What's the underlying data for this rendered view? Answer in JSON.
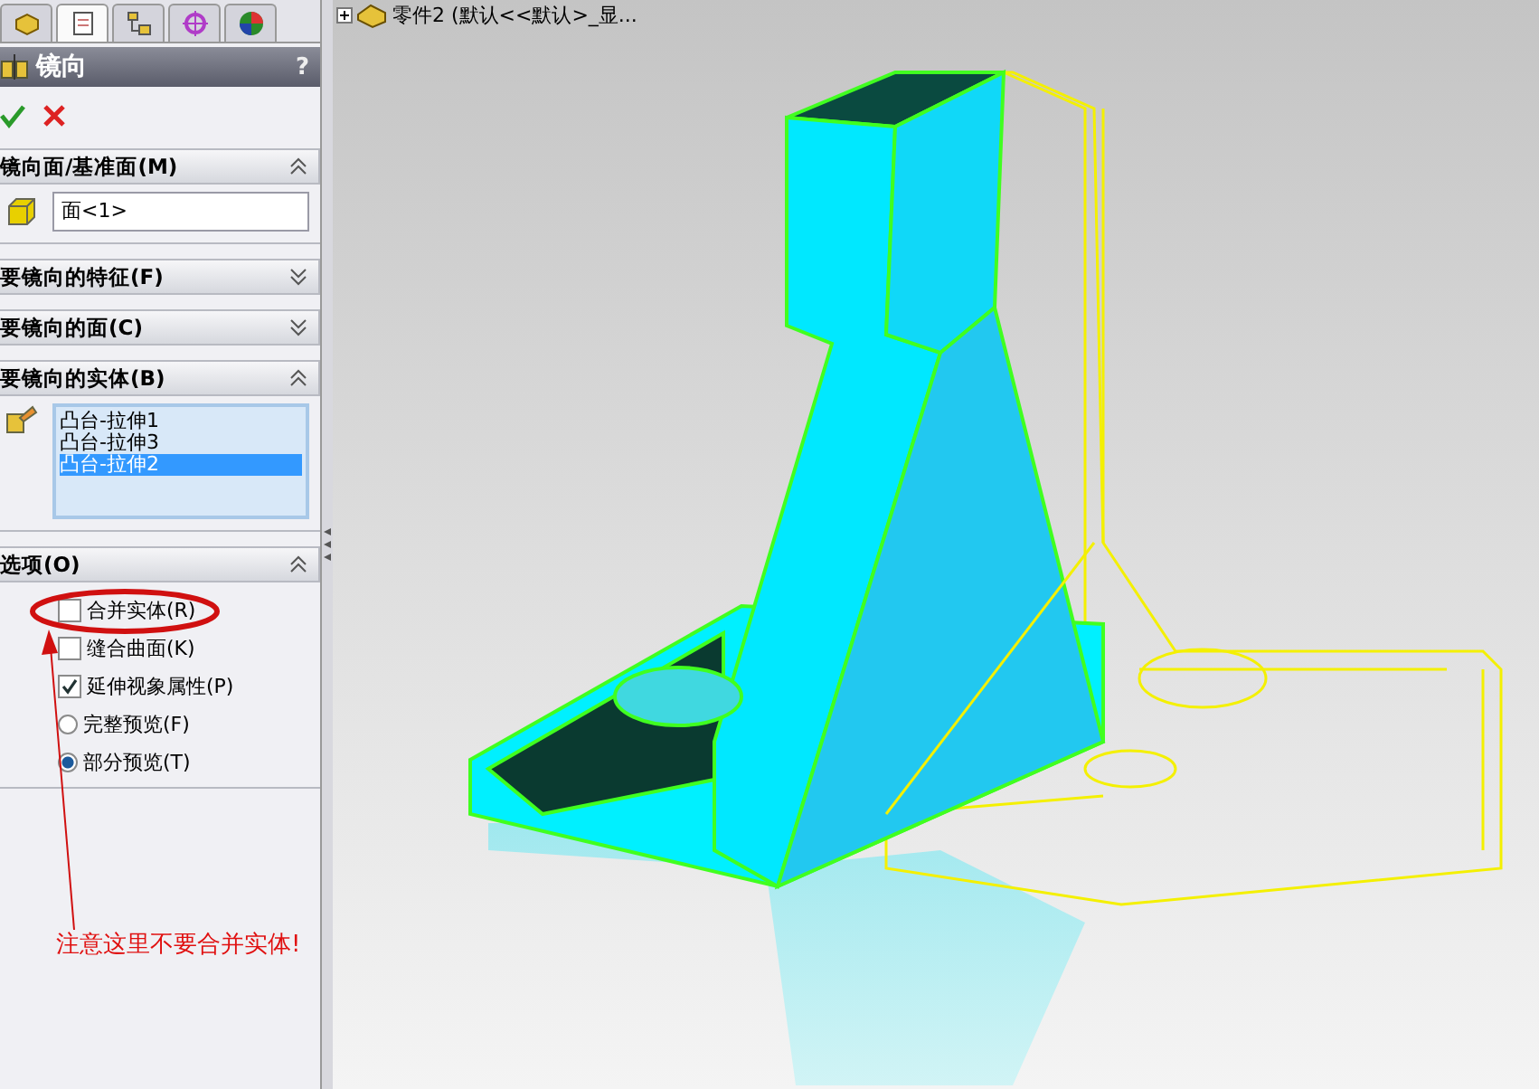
{
  "tabs": [
    {
      "selected": false
    },
    {
      "selected": true
    },
    {
      "selected": false
    },
    {
      "selected": false
    },
    {
      "selected": false
    }
  ],
  "panel": {
    "title": "镜向",
    "help": "?"
  },
  "sections": [
    {
      "title": "镜向面/基准面(M)",
      "expanded": true,
      "kind": "field",
      "value": "面<1>"
    },
    {
      "title": "要镜向的特征(F)",
      "expanded": false
    },
    {
      "title": "要镜向的面(C)",
      "expanded": false
    },
    {
      "title": "要镜向的实体(B)",
      "expanded": true,
      "kind": "list",
      "items": [
        {
          "label": "凸台-拉伸1",
          "selected": false
        },
        {
          "label": "凸台-拉伸3",
          "selected": false
        },
        {
          "label": "凸台-拉伸2",
          "selected": true
        }
      ]
    },
    {
      "title": "选项(O)",
      "expanded": true,
      "kind": "options",
      "options": [
        {
          "kind": "checkbox",
          "label": "合并实体(R)",
          "checked": false
        },
        {
          "kind": "checkbox",
          "label": "缝合曲面(K)",
          "checked": false
        },
        {
          "kind": "checkbox",
          "label": "延伸视象属性(P)",
          "checked": true
        },
        {
          "kind": "radio",
          "label": "完整预览(F)",
          "checked": false
        },
        {
          "kind": "radio",
          "label": "部分预览(T)",
          "checked": true
        }
      ]
    }
  ],
  "annotation": "注意这里不要合并实体!",
  "tree": {
    "label": "零件2  (默认<<默认>_显..."
  }
}
